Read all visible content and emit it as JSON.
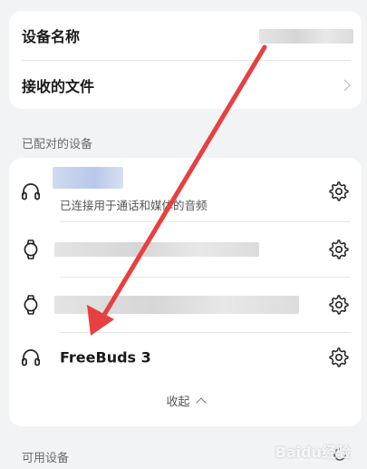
{
  "settings": {
    "device_name_label": "设备名称",
    "received_files_label": "接收的文件"
  },
  "paired": {
    "section_label": "已配对的设备",
    "devices": [
      {
        "icon": "headphones-icon",
        "name": "",
        "status": "已连接用于通话和媒体的音频"
      },
      {
        "icon": "smartwatch-icon",
        "name": ""
      },
      {
        "icon": "smartwatch-icon",
        "name": ""
      },
      {
        "icon": "headphones-icon",
        "name": "FreeBuds 3"
      }
    ],
    "collapse_label": "收起"
  },
  "available": {
    "section_label": "可用设备"
  },
  "annotation": {
    "arrow_color": "#e84040"
  },
  "watermark": "Baidu经验"
}
